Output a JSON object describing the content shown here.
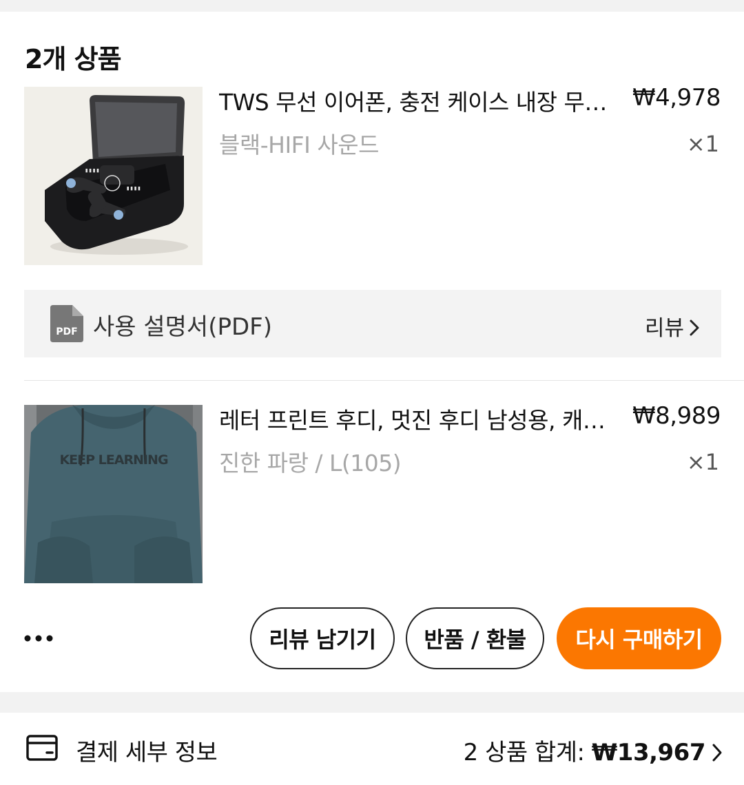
{
  "order": {
    "items_title": "2개 상품",
    "items": [
      {
        "name": "TWS 무선 이어폰, 충전 케이스 내장 무선 이어폰",
        "variant": "블랙-HIFI 사운드",
        "price": "₩4,978",
        "qty": "×1",
        "image_icon": "earbuds-product-image"
      },
      {
        "name": "레터 프린트 후디, 멋진 후디 남성용, 캐주얼",
        "variant": "진한 파랑 / L(105)",
        "price": "₩8,989",
        "qty": "×1",
        "image_icon": "hoodie-product-image",
        "image_text": "KEEP LEARNING"
      }
    ],
    "manual": {
      "icon_text": "PDF",
      "label": "사용 설명서(PDF)",
      "review_link": "리뷰"
    },
    "actions": {
      "more_icon": "more-dots-icon",
      "leave_review": "리뷰 남기기",
      "return_refund": "반품 / 환불",
      "buy_again": "다시 구매하기"
    }
  },
  "footer": {
    "icon": "credit-card-icon",
    "payment_details": "결제 세부 정보",
    "total_prefix": "2 상품 합계:",
    "total_amount": "₩13,967"
  },
  "colors": {
    "accent": "#fb7701",
    "muted_text": "#a7a7a7",
    "page_bg": "#f2f2f2"
  }
}
